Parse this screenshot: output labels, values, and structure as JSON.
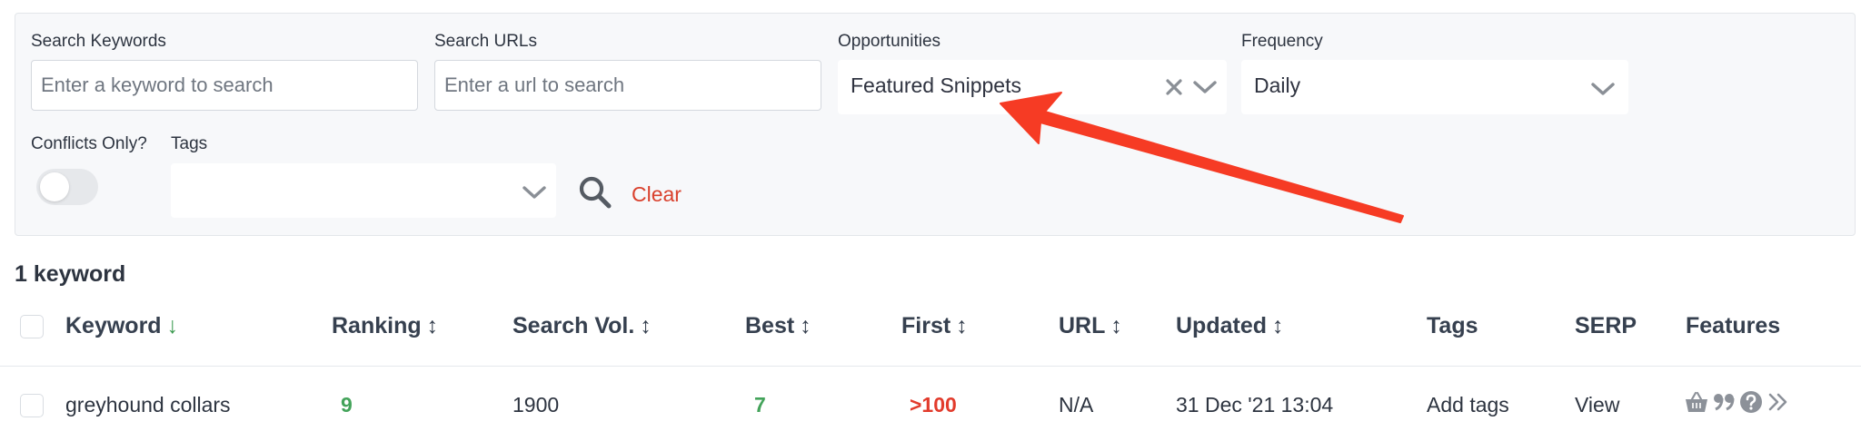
{
  "filters": {
    "search_keywords": {
      "label": "Search Keywords",
      "placeholder": "Enter a keyword to search"
    },
    "search_urls": {
      "label": "Search URLs",
      "placeholder": "Enter a url to search"
    },
    "opportunities": {
      "label": "Opportunities",
      "value": "Featured Snippets"
    },
    "frequency": {
      "label": "Frequency",
      "value": "Daily"
    },
    "conflicts_only": {
      "label": "Conflicts Only?",
      "enabled": false
    },
    "tags": {
      "label": "Tags",
      "value": ""
    },
    "clear_label": "Clear"
  },
  "result_count": "1 keyword",
  "table": {
    "columns": {
      "keyword": "Keyword",
      "ranking": "Ranking",
      "search_vol": "Search Vol.",
      "best": "Best",
      "first": "First",
      "url": "URL",
      "updated": "Updated",
      "tags": "Tags",
      "serp": "SERP",
      "features": "Features"
    },
    "sort_glyph": "↕",
    "sort_active_glyph": "↓",
    "rows": [
      {
        "keyword": "greyhound collars",
        "ranking": "9",
        "search_vol": "1900",
        "best": "7",
        "first": ">100",
        "url": "N/A",
        "updated": "31 Dec '21 13:04",
        "tags": "Add tags",
        "serp": "View",
        "features": [
          "shopping-basket-icon",
          "quote-icon",
          "question-icon",
          "chevrons-right-icon"
        ]
      }
    ]
  },
  "colors": {
    "annotation_arrow": "#f63b24",
    "clear_link": "#d9402c",
    "positive": "#43a35a",
    "negative": "#e23b2c"
  }
}
